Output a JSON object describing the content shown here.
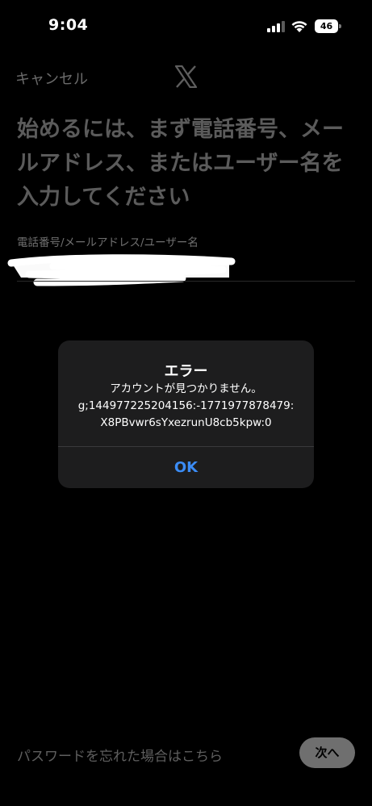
{
  "status_bar": {
    "time": "9:04",
    "battery": "46"
  },
  "header": {
    "cancel_label": "キャンセル"
  },
  "headline": "始めるには、まず電話番号、メールアドレス、またはユーザー名を入力してください",
  "field": {
    "label": "電話番号/メールアドレス/ユーザー名"
  },
  "dialog": {
    "title": "エラー",
    "message": "アカウントが見つかりません。\ng;144977225204156:-1771977878479:\nX8PBvwr6sYxezrunU8cb5kpw:0",
    "button_label": "OK"
  },
  "footer": {
    "forgot_label": "パスワードを忘れた場合はこちら",
    "next_label": "次へ"
  }
}
